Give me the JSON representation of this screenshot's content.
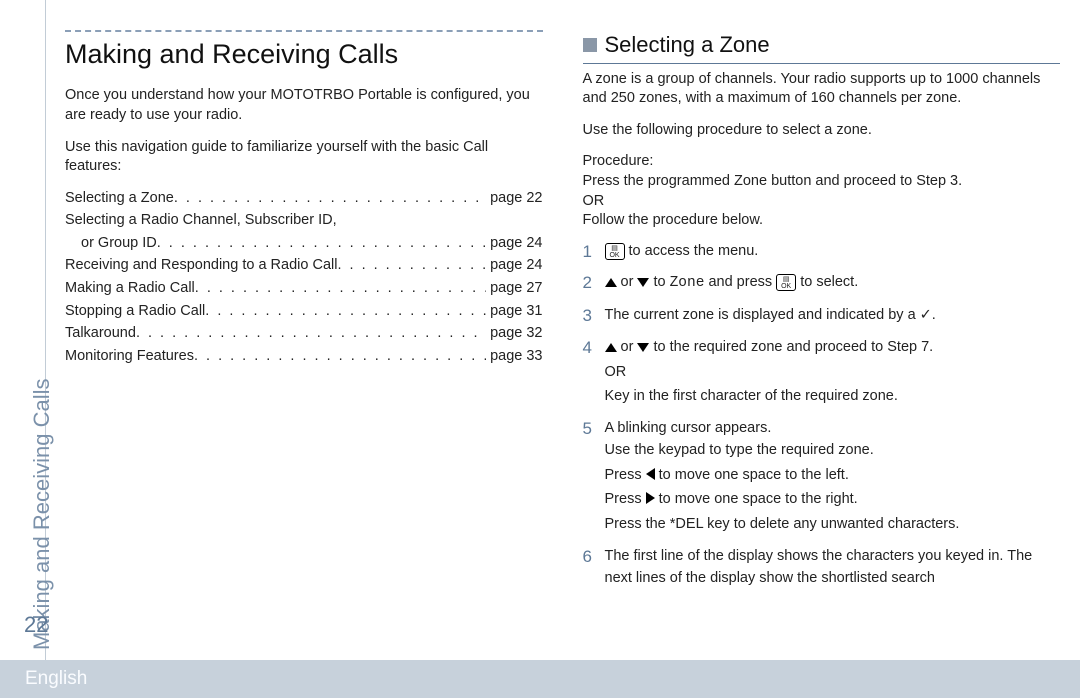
{
  "vertical_tab": "Making and Receiving Calls",
  "page_number": "22",
  "footer_lang": "English",
  "left": {
    "chapter_title": "Making and Receiving Calls",
    "intro_1": "Once you understand how your MOTOTRBO Portable is configured, you are ready to use your radio.",
    "intro_2": "Use this navigation guide to familiarize yourself with the basic Call features:",
    "toc": [
      {
        "label": "Selecting a Zone",
        "page": "page 22"
      },
      {
        "label": "Selecting a Radio Channel, Subscriber ID,",
        "page": ""
      },
      {
        "label_indent": "or Group ID",
        "page": "page 24"
      },
      {
        "label": "Receiving and Responding to a Radio Call",
        "page": "page 24"
      },
      {
        "label": "Making a Radio Call",
        "page": "page 27"
      },
      {
        "label": "Stopping a Radio Call",
        "page": "page 31"
      },
      {
        "label": "Talkaround",
        "page": "page 32"
      },
      {
        "label": "Monitoring Features",
        "page": "page 33"
      }
    ]
  },
  "right": {
    "sub_heading": "Selecting a Zone",
    "p1": "A zone is a group of channels. Your radio supports up to 1000 channels and 250 zones, with a maximum of 160 channels per zone.",
    "p2": "Use the following procedure to select a zone.",
    "proc_label": "Procedure:",
    "proc_line1": "Press the programmed Zone button and proceed to Step 3.",
    "proc_or": "OR",
    "proc_line2": "Follow the procedure below.",
    "key_ok": "OK",
    "zone_word": "Zone",
    "steps": {
      "s1_tail": " to access the menu.",
      "s2_mid1": " or ",
      "s2_mid2": " to ",
      "s2_mid3": " and press ",
      "s2_tail": " to select.",
      "s3": "The current zone is displayed and indicated by a ✓.",
      "s4_mid1": " or ",
      "s4_mid2": " to the required zone and proceed to Step 7.",
      "s4_or": "OR",
      "s4_line2": "Key in the first character of the required zone.",
      "s5_a": "A blinking cursor appears.",
      "s5_b": "Use the keypad to type the required zone.",
      "s5_c_pre": "Press ",
      "s5_c_post": " to move one space to the left.",
      "s5_d_pre": "Press ",
      "s5_d_post": " to move one space to the right.",
      "s5_e": "Press the *DEL key to delete any unwanted characters.",
      "s6": "The first line of the display shows the characters you keyed in. The next lines of the display show the shortlisted search"
    },
    "step_nums": {
      "n1": "1",
      "n2": "2",
      "n3": "3",
      "n4": "4",
      "n5": "5",
      "n6": "6"
    }
  }
}
